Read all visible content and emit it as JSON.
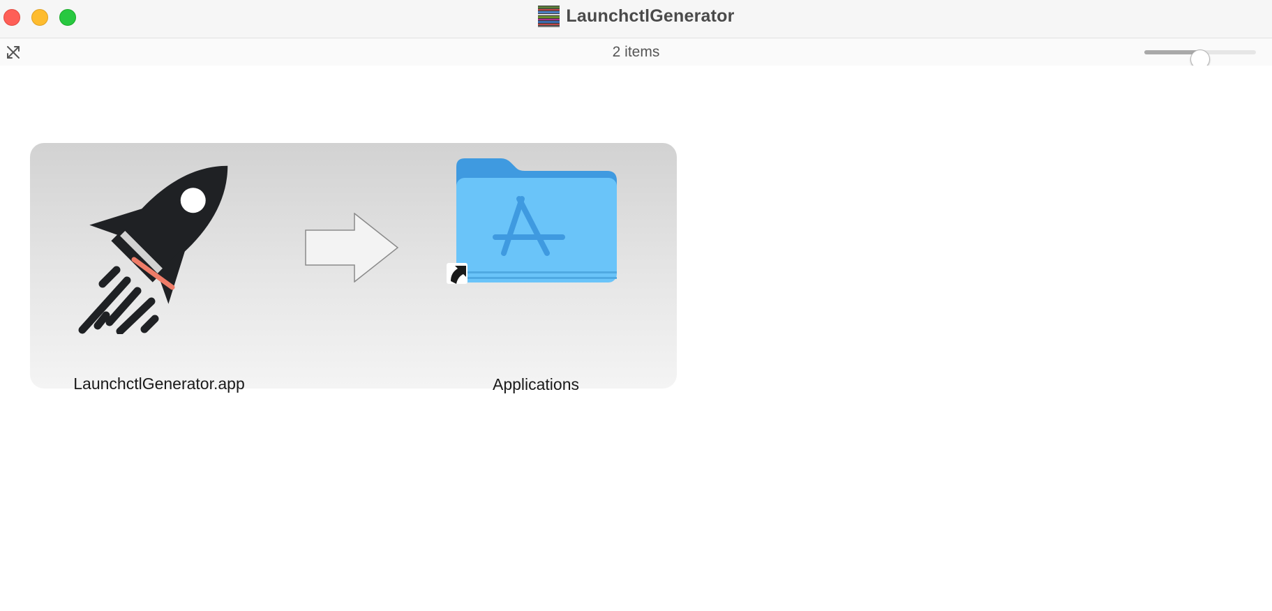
{
  "window": {
    "title": "LaunchctlGenerator",
    "title_icon": "disk-image-icon"
  },
  "statusbar": {
    "item_count": "2 items",
    "tool_icon": "arrange-icon",
    "icon_size_slider": {
      "value": 0.5
    }
  },
  "content": {
    "items": [
      {
        "label": "LaunchctlGenerator.app",
        "icon": "rocket-app-icon"
      },
      {
        "label": "Applications",
        "icon": "applications-folder-icon"
      }
    ],
    "arrow_icon": "right-arrow-icon"
  },
  "colors": {
    "close": "#fe5f57",
    "minimize": "#febc2e",
    "zoom": "#28c840",
    "folder": "#6ac4f9",
    "rocket": "#1f2124",
    "flame": "#ef7c68"
  }
}
